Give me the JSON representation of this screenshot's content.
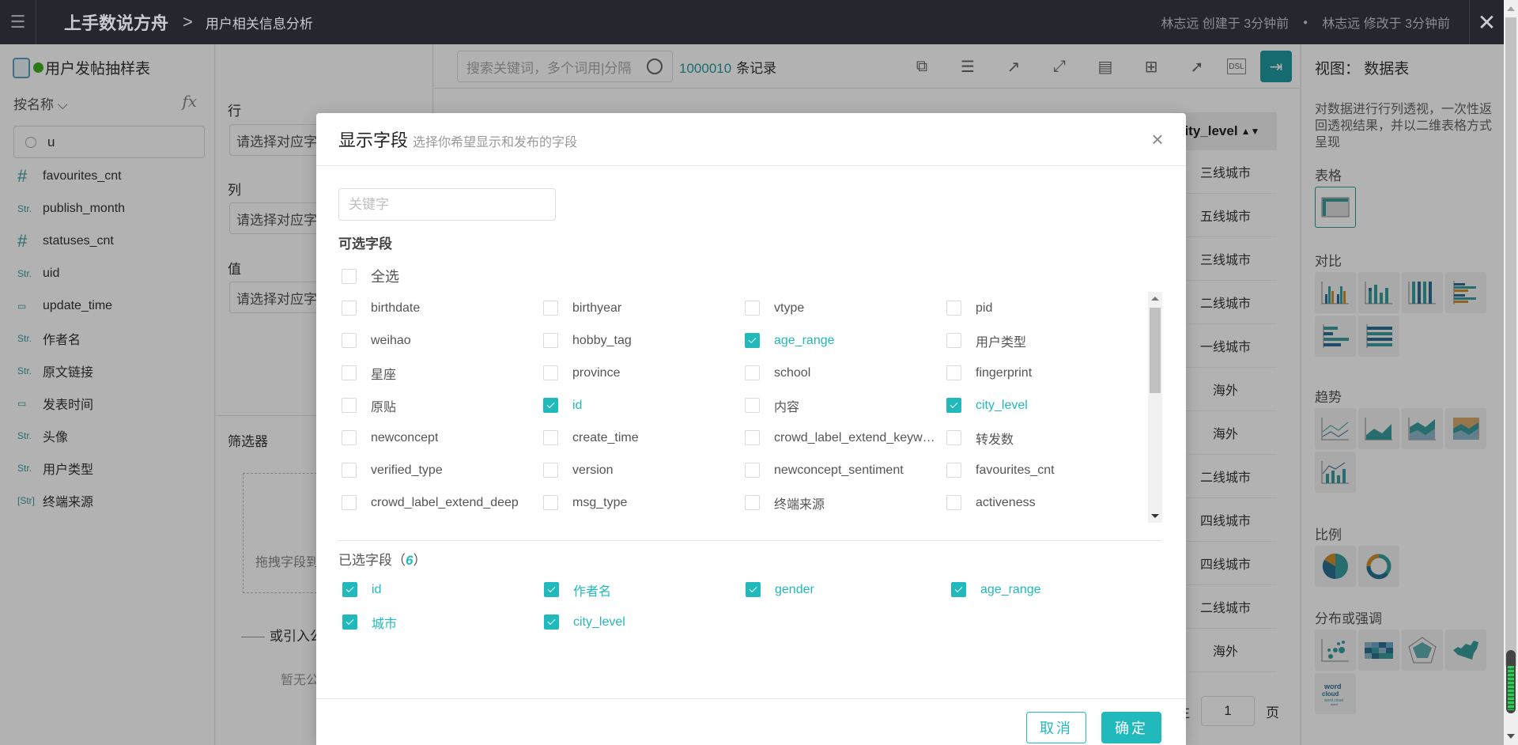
{
  "topbar": {
    "app_name": "上手数说方舟",
    "page_name": "用户相关信息分析",
    "created": "林志远 创建于 3分钟前",
    "modified": "林志远 修改于 3分钟前"
  },
  "left_panel": {
    "dataset_name": "用户发帖抽样表",
    "dataset_status_color": "#3db11f",
    "sort_label": "按名称",
    "fx_label": "fx",
    "search_value": "u",
    "fields": [
      {
        "type": "#",
        "type_icon": "number-icon",
        "name": "favourites_cnt"
      },
      {
        "type": "Str.",
        "type_icon": "string-icon",
        "name": "publish_month"
      },
      {
        "type": "#",
        "type_icon": "number-icon",
        "name": "statuses_cnt"
      },
      {
        "type": "Str.",
        "type_icon": "string-icon",
        "name": "uid"
      },
      {
        "type": "▭",
        "type_icon": "date-icon",
        "name": "update_time"
      },
      {
        "type": "Str.",
        "type_icon": "string-icon",
        "name": "作者名"
      },
      {
        "type": "Str.",
        "type_icon": "string-icon",
        "name": "原文链接"
      },
      {
        "type": "▭",
        "type_icon": "date-icon",
        "name": "发表时间"
      },
      {
        "type": "Str.",
        "type_icon": "string-icon",
        "name": "头像"
      },
      {
        "type": "Str.",
        "type_icon": "string-icon",
        "name": "用户类型"
      },
      {
        "type": "[Str]",
        "type_icon": "string-array-icon",
        "name": "终端来源"
      }
    ]
  },
  "config_panel": {
    "row_label": "行",
    "col_label": "列",
    "value_label": "值",
    "placeholder": "请选择对应字段",
    "filter_label": "筛选器",
    "drop_hint": "拖拽字段到此处",
    "or_import": "或引入公共筛选器",
    "no_common": "暂无公共筛选器"
  },
  "main": {
    "search_placeholder": "搜索关键词，多个词用|分隔",
    "record_count": "1000010",
    "record_suffix": "条记录",
    "toolbar_icons": [
      "copy-export-icon",
      "checklist-icon",
      "external-link-icon",
      "fullscreen-icon",
      "document-icon",
      "add-copy-icon",
      "rocket-icon",
      "dsl-icon",
      "collapse-panel-icon"
    ],
    "column_header": "city_level",
    "cells": [
      "三线城市",
      "五线城市",
      "三线城市",
      "二线城市",
      "一线城市",
      "海外",
      "海外",
      "二线城市",
      "四线城市",
      "四线城市",
      "二线城市",
      "海外"
    ],
    "pager_prefix": "往",
    "pager_value": "1",
    "pager_suffix": "页"
  },
  "right_panel": {
    "title": "视图：  数据表",
    "description": "对数据进行行列透视，一次性返回透视结果，并以二维表格方式呈现",
    "sections": {
      "table": "表格",
      "compare": "对比",
      "trend": "趋势",
      "ratio": "比例",
      "distribution": "分布或强调"
    }
  },
  "modal": {
    "title": "显示字段",
    "subtitle": "选择你希望显示和发布的字段",
    "keyword_placeholder": "关键字",
    "available_title": "可选字段",
    "select_all": "全选",
    "available_fields": [
      {
        "name": "birthdate",
        "checked": false
      },
      {
        "name": "birthyear",
        "checked": false
      },
      {
        "name": "vtype",
        "checked": false
      },
      {
        "name": "pid",
        "checked": false
      },
      {
        "name": "weihao",
        "checked": false
      },
      {
        "name": "hobby_tag",
        "checked": false
      },
      {
        "name": "age_range",
        "checked": true
      },
      {
        "name": "用户类型",
        "checked": false
      },
      {
        "name": "星座",
        "checked": false
      },
      {
        "name": "province",
        "checked": false
      },
      {
        "name": "school",
        "checked": false
      },
      {
        "name": "fingerprint",
        "checked": false
      },
      {
        "name": "原贴",
        "checked": false
      },
      {
        "name": "id",
        "checked": true
      },
      {
        "name": "内容",
        "checked": false
      },
      {
        "name": "city_level",
        "checked": true
      },
      {
        "name": "newconcept",
        "checked": false
      },
      {
        "name": "create_time",
        "checked": false
      },
      {
        "name": "crowd_label_extend_keyword",
        "checked": false
      },
      {
        "name": "转发数",
        "checked": false
      },
      {
        "name": "verified_type",
        "checked": false
      },
      {
        "name": "version",
        "checked": false
      },
      {
        "name": "newconcept_sentiment",
        "checked": false
      },
      {
        "name": "favourites_cnt",
        "checked": false
      },
      {
        "name": "crowd_label_extend_deep",
        "checked": false
      },
      {
        "name": "msg_type",
        "checked": false
      },
      {
        "name": "终端来源",
        "checked": false
      },
      {
        "name": "activeness",
        "checked": false
      }
    ],
    "selected_label": "已选字段（",
    "selected_count": "6",
    "selected_close": "）",
    "selected_fields": [
      "id",
      "作者名",
      "gender",
      "age_range",
      "城市",
      "city_level"
    ],
    "cancel_label": "取消",
    "ok_label": "确定",
    "accent_color": "#21b9bb"
  }
}
